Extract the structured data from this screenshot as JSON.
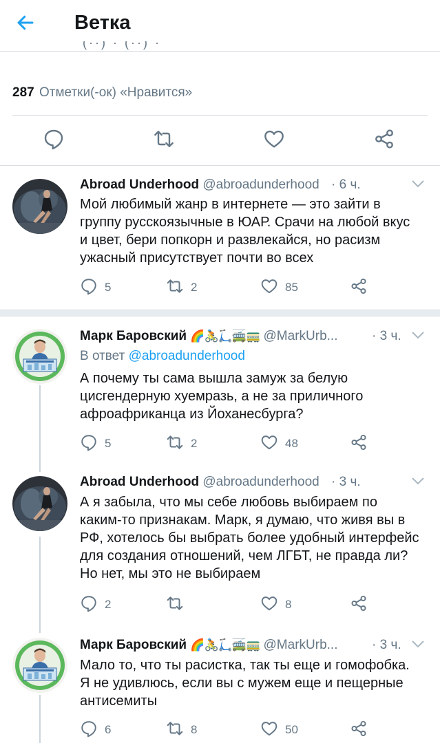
{
  "header": {
    "title": "Ветка",
    "back_icon": "arrow-left-icon",
    "accent": "#1da1f2"
  },
  "cut_off_text": "(··)  ·  (··)  ·",
  "likes": {
    "count": "287",
    "label": "Отметки(-ок) «Нравится»"
  },
  "main_actions": [
    "reply-icon",
    "retweet-icon",
    "like-icon",
    "share-icon"
  ],
  "tweets": [
    {
      "name": "Abroad Underhood",
      "emojis": "",
      "handle": "@abroadunderhood",
      "time": "· 6 ч.",
      "reply_to_label": "",
      "reply_to_handle": "",
      "text": "Мой любимый жанр в интернете — это зайти в\nгруппу русскоязычные в ЮАР. Срачи на любой вкус\nи цвет, бери попкорн и развлекайся, но расизм\nужасный присутствует почти во всех",
      "replies": "5",
      "retweets": "2",
      "likes": "85"
    },
    {
      "name": "Марк Баровский",
      "emojis": "🌈🚴🛴🚎🚃",
      "handle": "@MarkUrb...",
      "time": "· 3 ч.",
      "reply_to_label": "В ответ",
      "reply_to_handle": "@abroadunderhood",
      "text": "А почему ты сама вышла замуж за белую\nцисгендерную хуемразь, а не за приличного\nафроафриканца из Йоханесбурга?",
      "replies": "5",
      "retweets": "2",
      "likes": "48"
    },
    {
      "name": "Abroad Underhood",
      "emojis": "",
      "handle": "@abroadunderhood",
      "time": "· 3 ч.",
      "reply_to_label": "",
      "reply_to_handle": "",
      "text": "А я забыла, что мы себе любовь выбираем по\nкаким-то признакам. Марк, я думаю, что живя вы в\nРФ, хотелось бы выбрать более удобный интерфейс\nдля создания отношений, чем ЛГБТ, не правда ли?\nНо нет, мы это не выбираем",
      "replies": "2",
      "retweets": "",
      "likes": "8"
    },
    {
      "name": "Марк Баровский",
      "emojis": "🌈🚴🛴🚎🚃",
      "handle": "@MarkUrb...",
      "time": "· 3 ч.",
      "reply_to_label": "",
      "reply_to_handle": "",
      "text": "Мало то, что ты расистка, так ты еще и гомофобка.\nЯ не удивлюсь, если вы с мужем еще и пещерные\nантисемиты",
      "replies": "6",
      "retweets": "8",
      "likes": "50"
    }
  ]
}
